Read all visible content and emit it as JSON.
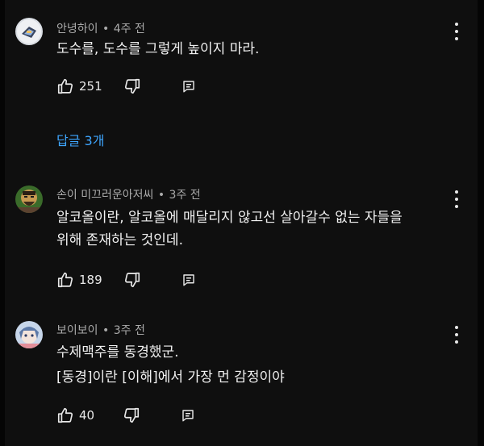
{
  "comments": [
    {
      "author": "안녕하이",
      "time": "4주 전",
      "lines": [
        "도수를, 도수를 그렇게 높이지 마라."
      ],
      "likes": "251",
      "replies_label": "답글 3개",
      "avatar_colors": {
        "bg": "#d9dde3",
        "fg": "#3a4660"
      }
    },
    {
      "author": "손이 미끄러운아저씨",
      "time": "3주 전",
      "lines": [
        "알코올이란, 알코올에 매달리지 않고선 살아갈수 없는 자들을",
        "위해 존재하는 것인데."
      ],
      "likes": "189",
      "avatar_colors": {
        "bg": "#3a6b2a",
        "fg": "#c89a52"
      }
    },
    {
      "author": "보이보이",
      "time": "3주 전",
      "lines": [
        "수제맥주를 동경했군.",
        "[동경]이란 [이해]에서 가장 먼 감정이야"
      ],
      "likes": "40",
      "avatar_colors": {
        "bg": "#c7d6ea",
        "fg": "#5c79a8"
      }
    }
  ],
  "meta_separator": "•",
  "colors": {
    "background": "#0f0f0f",
    "meta": "#aaaaaa",
    "link": "#3ea6ff",
    "text": "#f1f1f1"
  }
}
